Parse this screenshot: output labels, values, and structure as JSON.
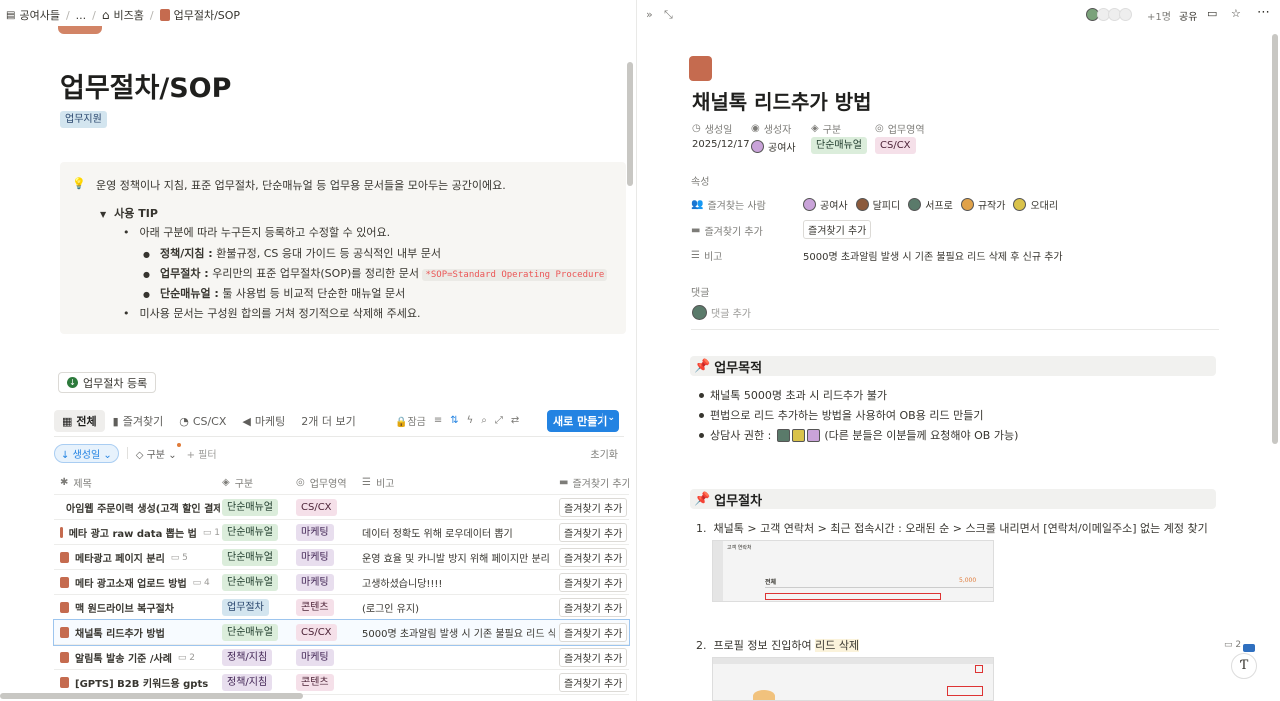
{
  "colors": {
    "accent": "#2383e2",
    "book": "#c56b4f"
  },
  "breadcrumb": {
    "workspace": "공여사들",
    "ellipsis": "...",
    "home": "비즈홈",
    "current": "업무절차/SOP"
  },
  "left": {
    "title": "업무절차/SOP",
    "page_tag": "업무지원",
    "callout": {
      "intro": "운영 정책이나 지침, 표준 업무절차, 단순매뉴얼 등 업무용 문서들을 모아두는 공간이에요.",
      "toggle": "사용 TIP",
      "b1": "아래 구분에 따라 누구든지 등록하고 수정할 수 있어요.",
      "s1_bold": "정책/지침 :",
      "s1_text": "환불규정, CS 응대 가이드 등 공식적인 내부 문서",
      "s2_bold": "업무절차 :",
      "s2_text": "우리만의 표준 업무절차(SOP)를 정리한 문서",
      "s2_code": "*SOP=Standard Operating Procedure",
      "s3_bold": "단순매뉴얼 :",
      "s3_text": "툴 사용법 등 비교적 단순한 매뉴얼 문서",
      "b2": "미사용 문서는 구성원 합의를 거쳐 정기적으로 삭제해 주세요."
    },
    "register_button": "업무절차 등록",
    "tabs": [
      "전체",
      "즐겨찾기",
      "CS/CX",
      "마케팅",
      "2개 더 보기"
    ],
    "toolbar": {
      "lock": "잠금",
      "new": "새로 만들기"
    },
    "filters": {
      "sort": "생성일",
      "group": "구분",
      "add_filter": "+ 필터",
      "reset": "초기화"
    },
    "columns": {
      "name": "제목",
      "type": "구분",
      "area": "업무영역",
      "note": "비고",
      "fav": "즐겨찾기 추가"
    },
    "rows": [
      {
        "name": "아임웹 주문이력 생성(고객 할인 결제",
        "comments": "",
        "type": "단순매뉴얼",
        "area": "CS/CX",
        "note": "",
        "fav": "즐겨찾기 추가"
      },
      {
        "name": "메타 광고 raw data 뽑는 법",
        "comments": "1",
        "type": "단순매뉴얼",
        "area": "마케팅",
        "note": "데이터 정확도 위해 로우데이터 뽑기",
        "fav": "즐겨찾기 추가"
      },
      {
        "name": "메타광고 페이지 분리",
        "comments": "5",
        "type": "단순매뉴얼",
        "area": "마케팅",
        "note": "운영 효율 및 카니발 방지 위해 페이지만 분리",
        "fav": "즐겨찾기 추가"
      },
      {
        "name": "메타 광고소재 업로드 방법",
        "comments": "4",
        "type": "단순매뉴얼",
        "area": "마케팅",
        "note": "고생하셨습니당!!!!",
        "fav": "즐겨찾기 추가"
      },
      {
        "name": "맥 원드라이브 복구절차",
        "comments": "",
        "type": "업무절차",
        "area": "콘텐츠",
        "note": "(로그인 유지)",
        "fav": "즐겨찾기 추가"
      },
      {
        "name": "채널톡 리드추가 방법",
        "comments": "",
        "type": "단순매뉴얼",
        "area": "CS/CX",
        "note": "5000명 초과알림 발생 시 기존 불필요 리드 삭제 후",
        "fav": "즐겨찾기 추가"
      },
      {
        "name": "알림톡 발송 기준 /사례",
        "comments": "2",
        "type": "정책/지침",
        "area": "마케팅",
        "note": "",
        "fav": "즐겨찾기 추가"
      },
      {
        "name": "[GPTS] B2B 키워드용 gpts",
        "comments": "",
        "type": "정책/지침",
        "area": "콘텐츠",
        "note": "",
        "fav": "즐겨찾기 추가"
      }
    ]
  },
  "right": {
    "topbar": {
      "more_count": "+1명",
      "share": "공유"
    },
    "title": "채널톡 리드추가 방법",
    "props": {
      "created_label": "생성일",
      "creator_label": "생성자",
      "type_label": "구분",
      "area_label": "업무영역",
      "created": "2025/12/17",
      "creator": "공여사",
      "type": "단순매뉴얼",
      "area": "CS/CX"
    },
    "attributes": "속성",
    "favs_label": "즐겨찾는 사람",
    "favs": [
      "공여사",
      "달피디",
      "서프로",
      "규작가",
      "오대리"
    ],
    "fav_add_label": "즐겨찾기 추가",
    "fav_add_button": "즐겨찾기 추가",
    "note_label": "비고",
    "note": "5000명 초과알림 발생 시 기존 불필요 리드 삭제 후 신규 추가",
    "comments_label": "댓글",
    "comment_placeholder": "댓글 추가",
    "section1": "업무목적",
    "purpose": [
      "채널톡 5000명 초과 시 리드추가 불가",
      "편법으로 리드 추가하는 방법을 사용하여 OB용 리드 만들기",
      "상담사 권한 :"
    ],
    "purpose_tail": "(다른 분들은 이분들께 요청해야 OB 가능)",
    "section2": "업무절차",
    "step1": "채널톡 > 고객 연락처 > 최근 접속시간 : 오래된 순 > 스크롤 내리면서 [연락처/이메일주소] 없는 계정 찾기",
    "step2_pre": "프로필 정보 진입하여",
    "step2_hl": "리드 삭제",
    "shot1_label": "고객 연락처",
    "shot1_count": "5,000",
    "shot1_title": "전체",
    "badge_count": "2"
  }
}
